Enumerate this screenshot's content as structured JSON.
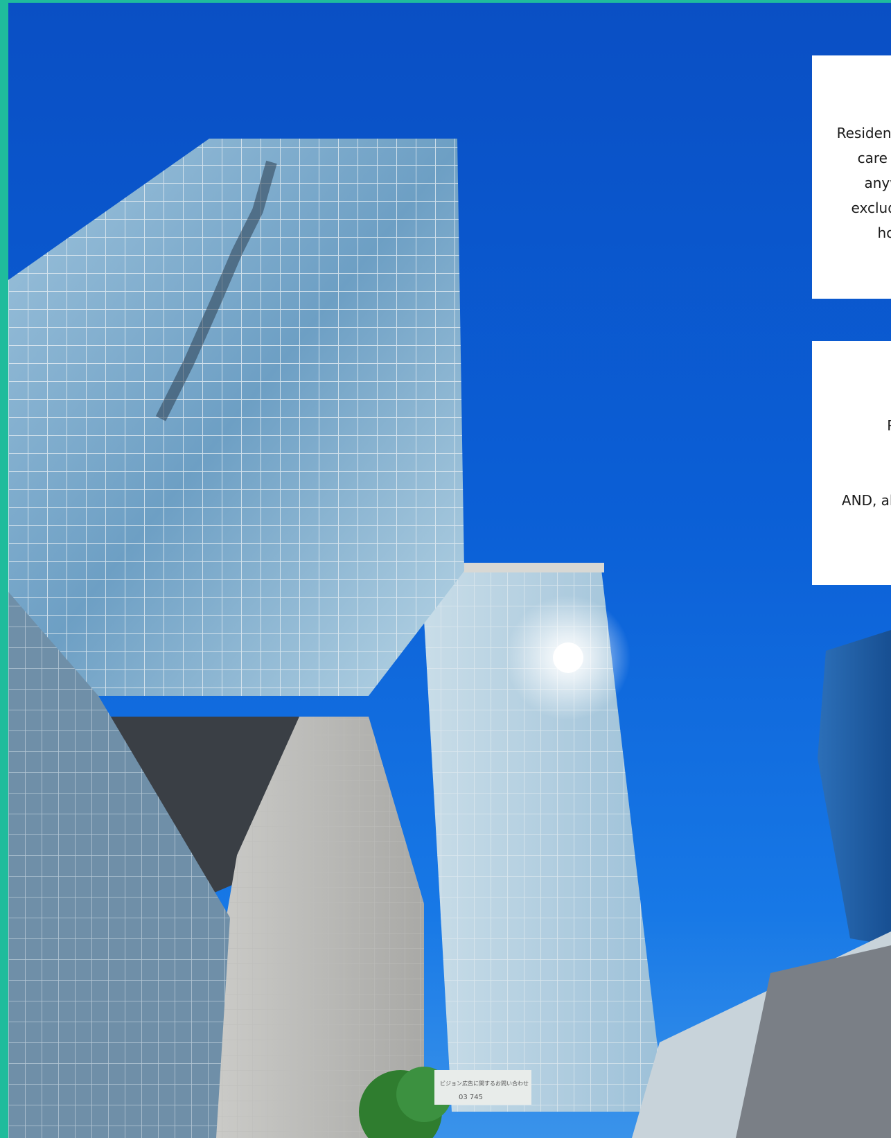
{
  "page": {
    "border_color": "#1fbc9c",
    "sky_color": "#0b5fd6"
  },
  "card_1": {
    "lines": [
      "Resident",
      "care f",
      "anyw",
      "excludi",
      "ho"
    ]
  },
  "card_2": {
    "lines": [
      "Pl",
      "AND, all"
    ]
  },
  "scene": {
    "sign_text": "ビジョン広告に関するお問い合わせ",
    "sign_number": "03 745"
  }
}
